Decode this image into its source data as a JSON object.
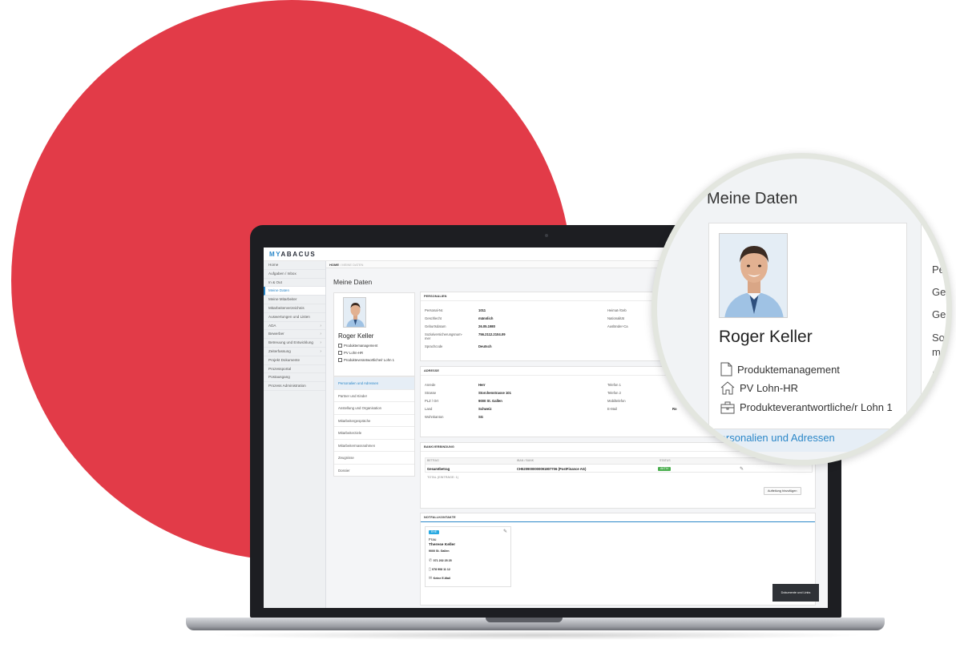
{
  "app": {
    "logo_prefix": "MY",
    "logo_suffix": "ABACUS"
  },
  "breadcrumb": {
    "home": "HOME",
    "separator": "/",
    "current": "MEINE DATEN"
  },
  "sidebar": {
    "items": [
      {
        "label": "Home",
        "active": false,
        "has_submenu": false
      },
      {
        "label": "Aufgaben / Inbox",
        "active": false,
        "has_submenu": false
      },
      {
        "label": "In & Out",
        "active": false,
        "has_submenu": false
      },
      {
        "label": "Meine Daten",
        "active": true,
        "has_submenu": false
      },
      {
        "label": "Meine Mitarbeiter",
        "active": false,
        "has_submenu": false
      },
      {
        "label": "Mitarbeiterverzeichnis",
        "active": false,
        "has_submenu": false
      },
      {
        "label": "Auswertungen und Listen",
        "active": false,
        "has_submenu": false
      },
      {
        "label": "ADA",
        "active": false,
        "has_submenu": true
      },
      {
        "label": "Bewerber",
        "active": false,
        "has_submenu": true
      },
      {
        "label": "Betreuung und Entwicklung",
        "active": false,
        "has_submenu": true
      },
      {
        "label": "Zeiterfassung",
        "active": false,
        "has_submenu": true
      },
      {
        "label": "Projekt Dokumente",
        "active": false,
        "has_submenu": false
      },
      {
        "label": "Prozessportal",
        "active": false,
        "has_submenu": false
      },
      {
        "label": "Postausgang",
        "active": false,
        "has_submenu": false
      },
      {
        "label": "Prozess Administration",
        "active": false,
        "has_submenu": false
      }
    ],
    "chevron": "›"
  },
  "page": {
    "title": "Meine Daten"
  },
  "profile": {
    "name": "Roger Keller",
    "department": "Produktemanagement",
    "group": "PV Lohn-HR",
    "role": "Produkteverantwortliche/r Lohn 1"
  },
  "tabs": [
    {
      "label": "Personalien und Adressen",
      "active": true
    },
    {
      "label": "Partner und Kinder",
      "active": false
    },
    {
      "label": "Anstellung und Organisation",
      "active": false
    },
    {
      "label": "Mitarbeitergespräche",
      "active": false
    },
    {
      "label": "Mitarbeiterziele",
      "active": false
    },
    {
      "label": "Mitarbeitermassnahmen",
      "active": false
    },
    {
      "label": "Zeugnisse",
      "active": false
    },
    {
      "label": "Dossier",
      "active": false
    }
  ],
  "personalien": {
    "title": "PERSONALIEN",
    "fields": [
      {
        "label": "Personal-Nr.",
        "value": "1011"
      },
      {
        "label": "Geschlecht",
        "value": "männlich"
      },
      {
        "label": "Geburtsdatum",
        "value": "26.05.1980"
      },
      {
        "label": "Sozialversicherungsnum-mer",
        "value": "756.2112.2104.09"
      },
      {
        "label": "Sprachcode",
        "value": "Deutsch"
      }
    ],
    "right_labels": [
      "Heimat-/Geb",
      "Nationalität",
      "Ausländer-Ca"
    ]
  },
  "adresse": {
    "title": "ADRESSE",
    "fields": [
      {
        "label": "Anrede",
        "value": "Herr"
      },
      {
        "label": "Strasse",
        "value": "Storchenstrasse 101"
      },
      {
        "label": "PLZ / Ort",
        "value": "9000 St. Gallen"
      },
      {
        "label": "Land",
        "value": "Schweiz"
      },
      {
        "label": "Wohnkanton",
        "value": "SG"
      }
    ],
    "right_labels": [
      "Telefon 1",
      "Telefon 2",
      "Mobiltelefon",
      "E-Mail"
    ],
    "email_partial": "Ro"
  },
  "bank": {
    "title": "BANKVERBINDUNG",
    "columns": [
      "BETRAG",
      "IBAN / BANK",
      "STATUS"
    ],
    "row": {
      "betrag": "Gesamtbetrag",
      "iban": "CH5209000000091807706 (PostFinance AG)",
      "status": "AKTIV"
    },
    "total": "TOTAL (EINTRÄGE: 1)",
    "add_button": "Aufteilung hinzufügen"
  },
  "notfall": {
    "title": "NOTFALLKONTAKTE",
    "badge": "EHE",
    "salutation": "Frau",
    "name": "Therese Keller",
    "city": "9000 St. Gallen",
    "phone": "071 202 25 25",
    "mobile": "078 908 11 12",
    "email": "Keine E-Mail"
  },
  "footer_button": "Dokumente und Links",
  "magnifier": {
    "title": "Meine Daten",
    "name": "Roger Keller",
    "department": "Produktemanagement",
    "group": "PV Lohn-HR",
    "role": "Produkteverantwortliche/r Lohn 1",
    "active_tab": "Personalien und Adressen",
    "side_labels": [
      "Pe",
      "Ges",
      "Geb",
      "Soz",
      "me",
      "S"
    ]
  },
  "colors": {
    "brand_red": "#e23b48",
    "accent_blue": "#2b87c8",
    "status_green": "#4caf50"
  }
}
